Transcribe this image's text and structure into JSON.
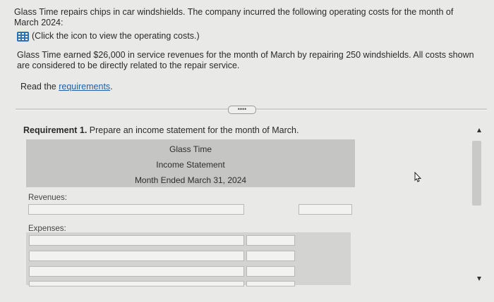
{
  "intro_text": "Glass Time repairs chips in car windshields. The company incurred the following operating costs for the month of March 2024:",
  "calc_link_text": "(Click the icon to view the operating costs.)",
  "revenue_text": "Glass Time earned $26,000 in service revenues for the month of March by repairing 250 windshields. All costs shown are considered to be directly related to the repair service.",
  "read_prefix": "Read the ",
  "requirements_link": "requirements",
  "read_suffix": ".",
  "expand_label": "••••",
  "requirement": {
    "bold": "Requirement 1.",
    "text": " Prepare an income statement for the month of March."
  },
  "statement": {
    "company": "Glass Time",
    "title": "Income Statement",
    "period": "Month Ended March 31, 2024"
  },
  "labels": {
    "revenues": "Revenues:",
    "expenses": "Expenses:"
  },
  "inputs": {
    "revenue_label": "",
    "revenue_amount": "",
    "expense_rows": [
      {
        "label": "",
        "amount": ""
      },
      {
        "label": "",
        "amount": ""
      },
      {
        "label": "",
        "amount": ""
      },
      {
        "label": "",
        "amount": ""
      }
    ]
  },
  "icons": {
    "calculator": "calculator-icon",
    "scroll_up": "triangle-up",
    "scroll_down": "triangle-down",
    "cursor": "mouse-pointer"
  }
}
